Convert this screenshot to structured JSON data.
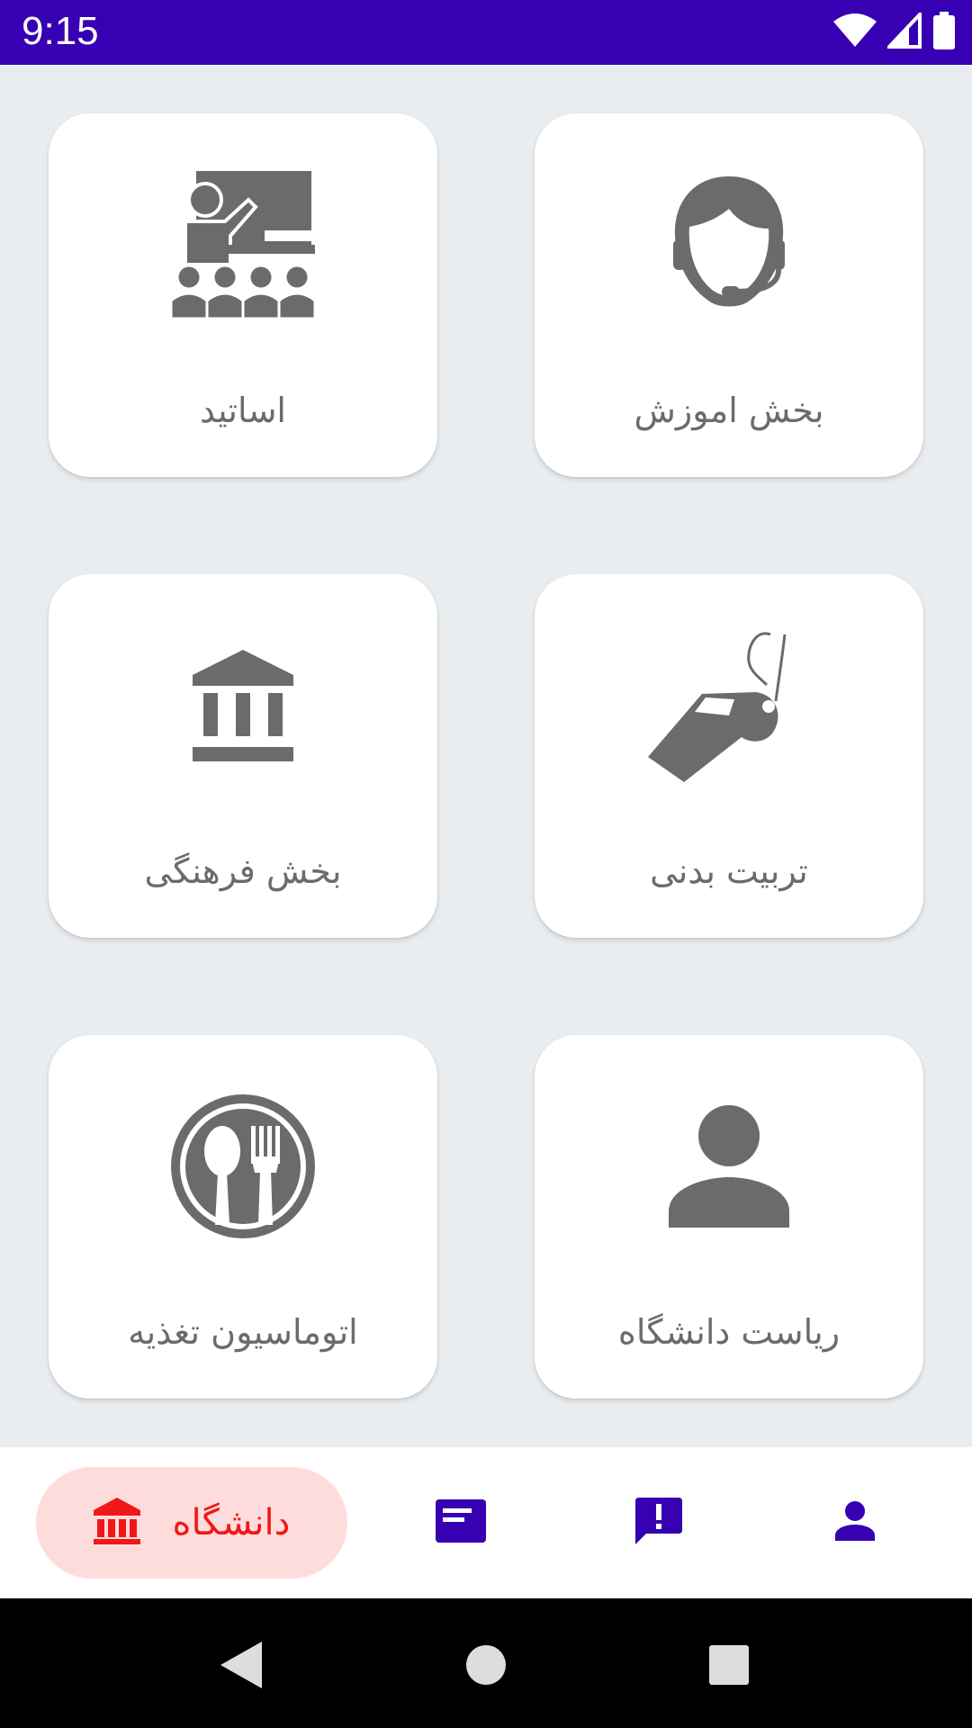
{
  "status_bar": {
    "time": "9:15",
    "icons": [
      "wifi-icon",
      "cell-signal-icon",
      "battery-icon"
    ],
    "background": "#3700b3"
  },
  "cards": [
    {
      "label": "بخش اموزش",
      "icon": "headset-agent-icon"
    },
    {
      "label": "اساتید",
      "icon": "teacher-classroom-icon"
    },
    {
      "label": "تربیت بدنی",
      "icon": "whistle-icon"
    },
    {
      "label": "بخش فرهنگی",
      "icon": "museum-icon"
    },
    {
      "label": "ریاست دانشگاه",
      "icon": "person-icon"
    },
    {
      "label": "اتوماسیون تغذیه",
      "icon": "spoon-fork-plate-icon"
    }
  ],
  "bottom_nav": {
    "active": {
      "label": "دانشگاه",
      "icon": "university-icon",
      "color": "#f01818",
      "background": "#ffdcdc"
    },
    "items": [
      {
        "icon": "news-article-icon"
      },
      {
        "icon": "feedback-report-icon"
      },
      {
        "icon": "profile-person-icon"
      }
    ],
    "icon_color": "#3700b3"
  },
  "system_nav": [
    "back-icon",
    "home-icon",
    "recents-icon"
  ],
  "colors": {
    "icon_gray": "#6b6b6b",
    "background": "#eaedf0"
  }
}
